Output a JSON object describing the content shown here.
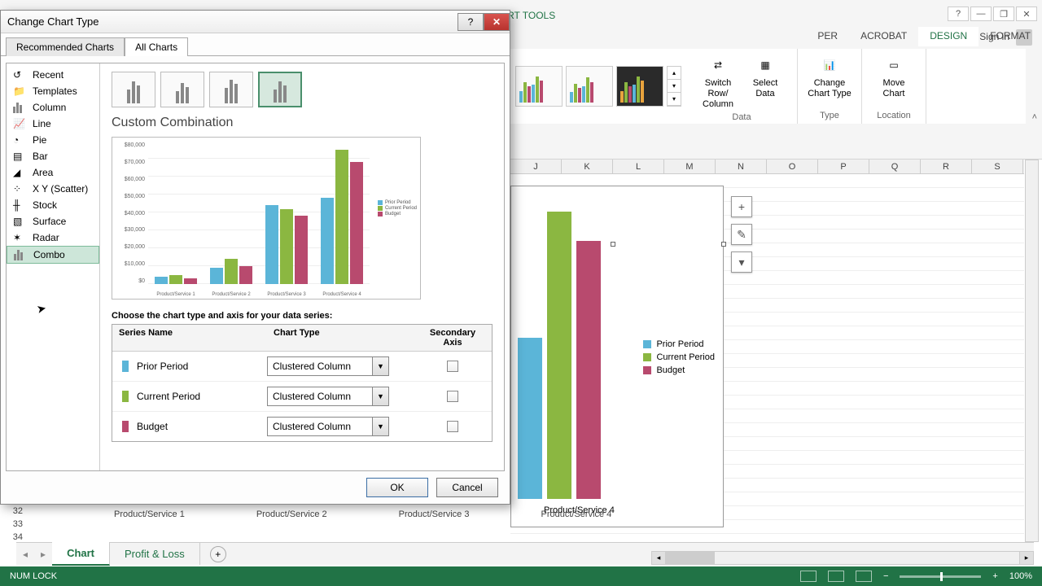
{
  "window": {
    "help_hint": "?",
    "minimize": "—",
    "restore": "❐",
    "close": "✕",
    "signin": "Sign in"
  },
  "ribbon": {
    "context_title": "CHART TOOLS",
    "tabs": {
      "developer": "PER",
      "acrobat": "ACROBAT",
      "design": "DESIGN",
      "format": "FORMAT"
    },
    "buttons": {
      "switch_row": "Switch Row/\nColumn",
      "select_data": "Select\nData",
      "change_type": "Change\nChart Type",
      "move_chart": "Move\nChart"
    },
    "groups": {
      "data": "Data",
      "type": "Type",
      "location": "Location"
    }
  },
  "colheaders": [
    "J",
    "K",
    "L",
    "M",
    "N",
    "O",
    "P",
    "Q",
    "R",
    "S"
  ],
  "rownums": [
    "32",
    "33",
    "34"
  ],
  "bg_xlabels": [
    "Product/Service 1",
    "Product/Service 2",
    "Product/Service 3",
    "Product/Service 4"
  ],
  "embedded_legend": {
    "prior": "Prior Period",
    "current": "Current Period",
    "budget": "Budget"
  },
  "embedded_xlabel": "Product/Service 4",
  "chart_floating_icons": {
    "add": "+",
    "brush": "✎",
    "filter": "▾"
  },
  "sheet_tabs": {
    "chart": "Chart",
    "pl": "Profit & Loss"
  },
  "status": {
    "numlock": "NUM LOCK",
    "zoom": "100%",
    "minus": "−",
    "plus": "+"
  },
  "dialog": {
    "title": "Change Chart Type",
    "help": "?",
    "close": "✕",
    "tabs": {
      "recommended": "Recommended Charts",
      "all": "All Charts"
    },
    "categories": [
      "Recent",
      "Templates",
      "Column",
      "Line",
      "Pie",
      "Bar",
      "Area",
      "X Y (Scatter)",
      "Stock",
      "Surface",
      "Radar",
      "Combo"
    ],
    "selected_category": "Combo",
    "pane_title": "Custom Combination",
    "series_instruction": "Choose the chart type and axis for your data series:",
    "table_head": {
      "name": "Series Name",
      "type": "Chart Type",
      "axis": "Secondary Axis"
    },
    "series": [
      {
        "name": "Prior Period",
        "type": "Clustered Column",
        "secondary": false,
        "color": "#5bb5d8"
      },
      {
        "name": "Current Period",
        "type": "Clustered Column",
        "secondary": false,
        "color": "#8bb741"
      },
      {
        "name": "Budget",
        "type": "Clustered Column",
        "secondary": false,
        "color": "#b84a6e"
      }
    ],
    "ok": "OK",
    "cancel": "Cancel"
  },
  "chart_data": {
    "type": "bar",
    "title": "",
    "xlabel": "",
    "ylabel": "",
    "ylim": [
      0,
      80000
    ],
    "yticks": [
      "$80,000",
      "$70,000",
      "$60,000",
      "$50,000",
      "$40,000",
      "$30,000",
      "$20,000",
      "$10,000",
      "$0"
    ],
    "categories": [
      "Product/Service 1",
      "Product/Service 2",
      "Product/Service 3",
      "Product/Service 4"
    ],
    "series": [
      {
        "name": "Prior Period",
        "color": "#5bb5d8",
        "values": [
          4000,
          9000,
          44000,
          48000
        ]
      },
      {
        "name": "Current Period",
        "color": "#8bb741",
        "values": [
          5000,
          14000,
          42000,
          75000
        ]
      },
      {
        "name": "Budget",
        "color": "#b84a6e",
        "values": [
          3000,
          10000,
          38000,
          68000
        ]
      }
    ]
  }
}
